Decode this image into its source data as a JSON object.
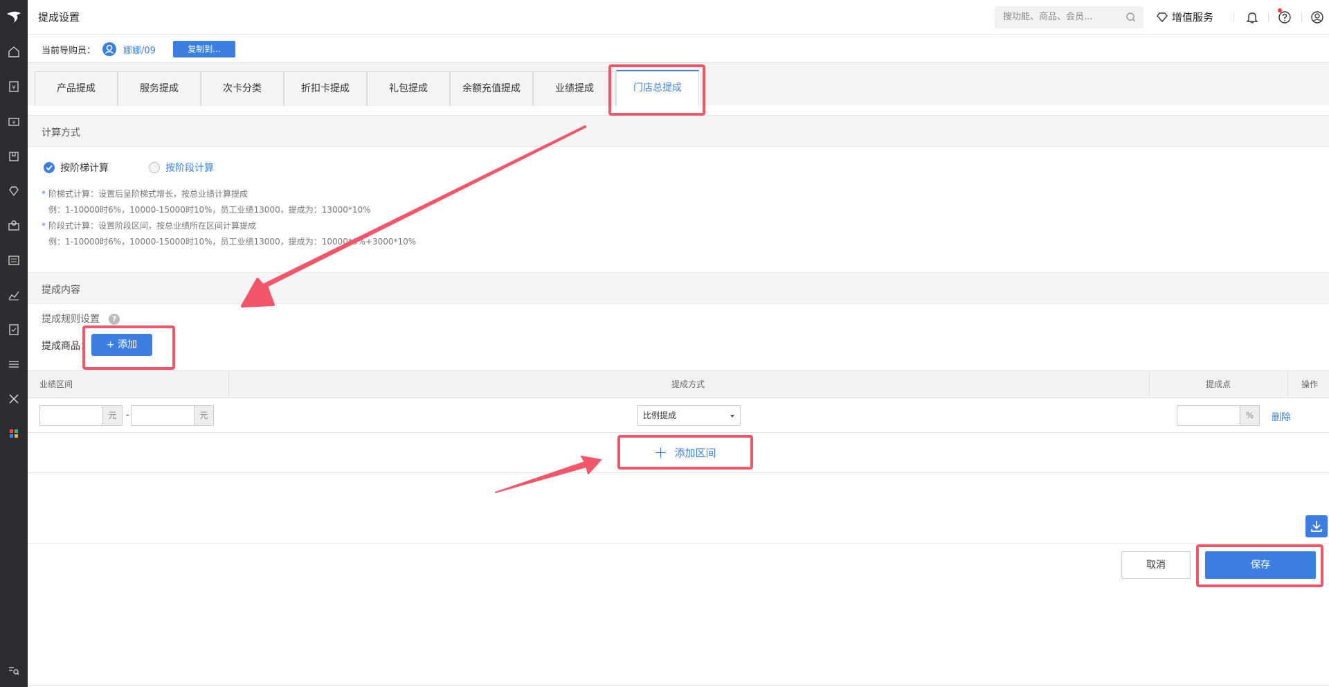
{
  "header": {
    "title": "提成设置",
    "search_placeholder": "搜功能、商品、会员...",
    "value_added_service": "增值服务",
    "notification_dot_color": "#e83a3a"
  },
  "guide": {
    "label": "当前导购员：",
    "name": "娜娜/09",
    "copy_button": "复制到..."
  },
  "tabs": [
    {
      "label": "产品提成",
      "active": false
    },
    {
      "label": "服务提成",
      "active": false
    },
    {
      "label": "次卡分类",
      "active": false
    },
    {
      "label": "折扣卡提成",
      "active": false
    },
    {
      "label": "礼包提成",
      "active": false
    },
    {
      "label": "余额充值提成",
      "active": false
    },
    {
      "label": "业绩提成",
      "active": false
    },
    {
      "label": "门店总提成",
      "active": true
    }
  ],
  "calc": {
    "section_title": "计算方式",
    "option_ladder": "按阶梯计算",
    "option_stage": "按阶段计算",
    "selected": "按阶梯计算",
    "notes": {
      "ladder_desc": "阶梯式计算：设置后呈阶梯式增长，按总业绩计算提成",
      "ladder_example": "例：1-10000时6%，10000-15000时10%，员工业绩13000，提成为：13000*10%",
      "stage_desc": "阶段式计算：设置阶段区间，按总业绩所在区间计算提成",
      "stage_example": "例：1-10000时6%，10000-15000时10%，员工业绩13000，提成为：10000*6%+3000*10%"
    }
  },
  "content": {
    "section_title": "提成内容",
    "rule_label": "提成规则设置",
    "goods_label": "提成商品：",
    "add_button": "添加",
    "table": {
      "headers": {
        "range": "业绩区间",
        "method": "提成方式",
        "point": "提成点",
        "action": "操作"
      },
      "rows": [
        {
          "from": "",
          "to": "",
          "unit": "元",
          "separator": "-",
          "method": "比例提成",
          "point": "",
          "point_unit": "%",
          "action": "删除"
        }
      ]
    },
    "add_range": "添加区间"
  },
  "footer": {
    "cancel": "取消",
    "save": "保存"
  },
  "colors": {
    "accent": "#3d7fe0",
    "sidebar": "#2b2d30",
    "annotation": "#f2566b"
  }
}
